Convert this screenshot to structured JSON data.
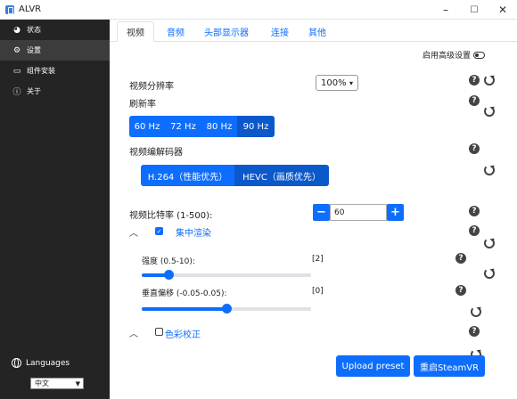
{
  "window": {
    "title": "ALVR",
    "minimize": "–",
    "maximize": "☐",
    "close": "✕"
  },
  "sidebar": {
    "items": [
      {
        "label": "状态",
        "icon": "dashboard-icon"
      },
      {
        "label": "设置",
        "icon": "gears-icon"
      },
      {
        "label": "组件安装",
        "icon": "headset-icon"
      },
      {
        "label": "关于",
        "icon": "info-icon"
      }
    ],
    "languages_label": "Languages",
    "language_value": "中文"
  },
  "tabs": [
    "视频",
    "音频",
    "头部显示器",
    "连接",
    "其他"
  ],
  "advanced_settings": "启用高级设置",
  "video": {
    "resolution_label": "视频分辨率",
    "resolution_value": "100%",
    "refresh_label": "刷新率",
    "refresh_options": [
      "60 Hz",
      "72 Hz",
      "80 Hz",
      "90 Hz"
    ],
    "refresh_selected": "90 Hz",
    "codec_label": "视频编解码器",
    "codec_options": [
      "H.264（性能优先）",
      "HEVC（画质优先）"
    ],
    "codec_selected": "HEVC（画质优先）",
    "bitrate_label": "视频比特率 (1-500):",
    "bitrate_value": "60",
    "foveated_label": "集中渲染",
    "foveated_checked": true,
    "strength_label": "强度 (0.5-10):",
    "strength_value": "[2]",
    "strength_fraction": 0.16,
    "offset_label": "垂直偏移 (-0.05-0.05):",
    "offset_value": "[0]",
    "offset_fraction": 0.5,
    "color_label": "色彩校正",
    "color_checked": false
  },
  "buttons": {
    "upload": "Upload preset",
    "restart": "重启SteamVR"
  },
  "colors": {
    "accent": "#0d6efd",
    "sidebar": "#242424"
  }
}
